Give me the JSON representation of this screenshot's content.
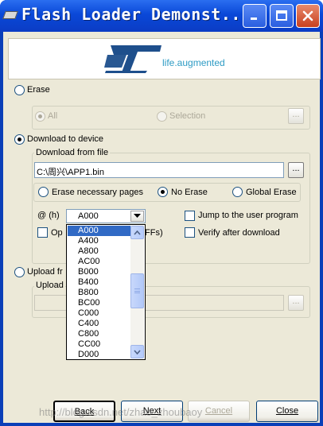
{
  "window": {
    "title": "Flash Loader Demonst..."
  },
  "logo": {
    "tagline": "life.augmented"
  },
  "erase": {
    "label": "Erase",
    "all_label": "All",
    "selection_label": "Selection",
    "dots_label": "..."
  },
  "download": {
    "label": "Download to device",
    "group_title": "Download from file",
    "file_path": "C:\\周兴\\APP1.bin",
    "browse_label": "...",
    "erase_pages_label": "Erase necessary pages",
    "no_erase_label": "No Erase",
    "global_erase_label": "Global Erase",
    "address_label": "@ (h)",
    "address_value": "A000",
    "jump_label": "Jump to the user program",
    "optimize_prefix": "Op",
    "optimize_suffix": "FFs)",
    "verify_label": "Verify after download",
    "address_options": [
      "A000",
      "A400",
      "A800",
      "AC00",
      "B000",
      "B400",
      "B800",
      "BC00",
      "C000",
      "C400",
      "C800",
      "CC00",
      "D000"
    ]
  },
  "upload": {
    "label": "Upload fr",
    "group_title": "Upload",
    "browse_label": "..."
  },
  "buttons": {
    "back": "Back",
    "next": "Next",
    "cancel": "Cancel",
    "close": "Close"
  },
  "watermark": "http://blog.csdn.net/zhao_zhoubaoy",
  "colors": {
    "titlebar": "#0a48d8",
    "accent": "#316ac5",
    "logo_blue": "#2d9bc4",
    "close_button": "#c8401e"
  }
}
